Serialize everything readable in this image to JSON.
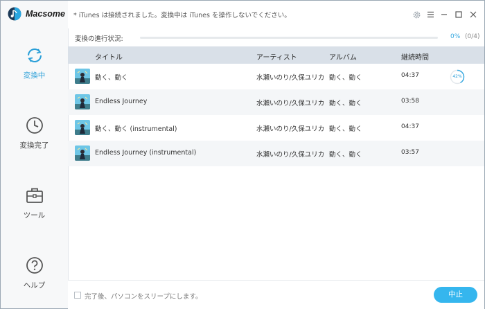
{
  "app": {
    "name": "Macsome"
  },
  "sidebar": {
    "items": [
      {
        "label": "変換中",
        "icon": "converting-icon",
        "active": true
      },
      {
        "label": "変換完了",
        "icon": "clock-icon",
        "active": false
      },
      {
        "label": "ツール",
        "icon": "toolbox-icon",
        "active": false
      },
      {
        "label": "ヘルプ",
        "icon": "help-icon",
        "active": false
      }
    ]
  },
  "topbar": {
    "notice": "* iTunes は接続されました。変換中は iTunes を操作しないでください。",
    "controls": [
      "settings-icon",
      "menu-icon",
      "minimize-icon",
      "maximize-icon",
      "close-icon"
    ]
  },
  "progress": {
    "label": "変換の進行状況:",
    "percent_text": "0%",
    "percent": 0,
    "count_text": "(0/4)"
  },
  "table": {
    "headers": {
      "title": "タイトル",
      "artist": "アーティスト",
      "album": "アルバム",
      "duration": "継続時間"
    },
    "rows": [
      {
        "title": "動く、動く",
        "artist": "水瀬いのり/久保ユリカ",
        "album": "動く、動く",
        "duration": "04:37",
        "progress_text": "42%",
        "progress": 42
      },
      {
        "title": "Endless Journey",
        "artist": "水瀬いのり/久保ユリカ",
        "album": "動く、動く",
        "duration": "03:58"
      },
      {
        "title": "動く、動く (instrumental)",
        "artist": "水瀬いのり/久保ユリカ",
        "album": "動く、動く",
        "duration": "04:37"
      },
      {
        "title": "Endless Journey (instrumental)",
        "artist": "水瀬いのり/久保ユリカ",
        "album": "動く、動く",
        "duration": "03:57"
      }
    ]
  },
  "bottom": {
    "sleep_label": "完了後、パソコンをスリープにします。",
    "sleep_checked": false,
    "stop_label": "中止"
  },
  "colors": {
    "accent": "#35a8e0",
    "header_bg": "#d9e0e8",
    "button": "#35b6ee"
  }
}
